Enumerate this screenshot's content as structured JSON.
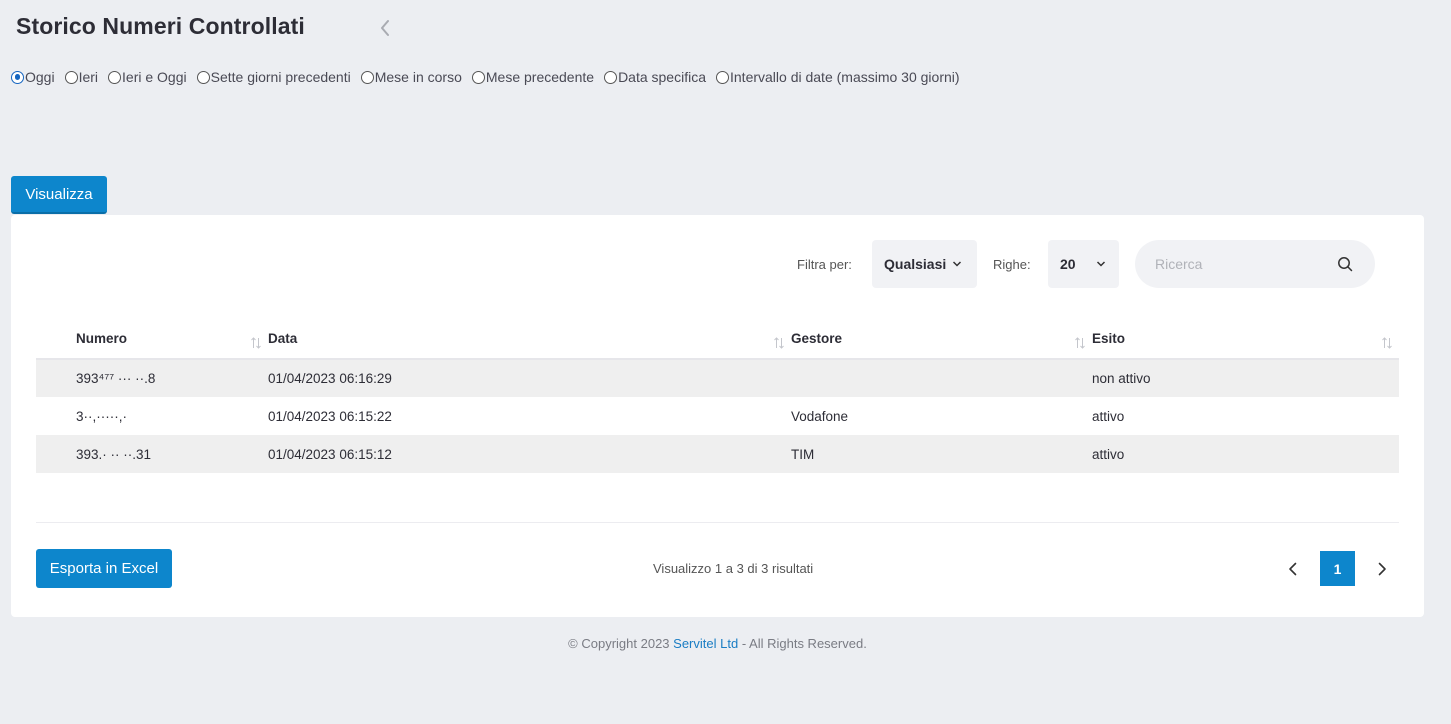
{
  "header": {
    "title": "Storico Numeri Controllati",
    "back_icon": "chevron-left-icon"
  },
  "date_filter": {
    "selected": "Oggi",
    "options": [
      "Oggi",
      "Ieri",
      "Ieri e Oggi",
      "Sette giorni precedenti",
      "Mese in corso",
      "Mese precedente",
      "Data specifica",
      "Intervallo di date (massimo 30 giorni)"
    ]
  },
  "actions": {
    "visualizza_label": "Visualizza"
  },
  "toolbar": {
    "filter_label": "Filtra per:",
    "filter_value": "Qualsiasi",
    "rows_label": "Righe:",
    "rows_value": "20",
    "search_placeholder": "Ricerca",
    "search_icon": "search-icon"
  },
  "table": {
    "columns": [
      "Numero",
      "Data",
      "Gestore",
      "Esito"
    ],
    "rows": [
      {
        "numero": "393⁴⁷⁷ ··· ··.8",
        "data": "01/04/2023 06:16:29",
        "gestore": "",
        "esito": "non attivo",
        "esito_color": "#d9141b"
      },
      {
        "numero": "3··,·····,·",
        "data": "01/04/2023 06:15:22",
        "gestore": "Vodafone",
        "esito": "attivo",
        "esito_color": "#2e8b2e"
      },
      {
        "numero": "393.·  ·· ··.31",
        "data": "01/04/2023 06:15:12",
        "gestore": "TIM",
        "esito": "attivo",
        "esito_color": "#2e8b2e"
      }
    ]
  },
  "footer_bar": {
    "export_label": "Esporta in Excel",
    "results_info": "Visualizzo 1 a 3 di 3 risultati",
    "current_page": "1"
  },
  "footer": {
    "prefix": "© Copyright 2023 ",
    "company": "Servitel Ltd",
    "suffix": " - All Rights Reserved."
  },
  "colors": {
    "accent": "#0d86cc",
    "negative": "#d9141b",
    "positive": "#2e8b2e",
    "background": "#eceef2"
  }
}
